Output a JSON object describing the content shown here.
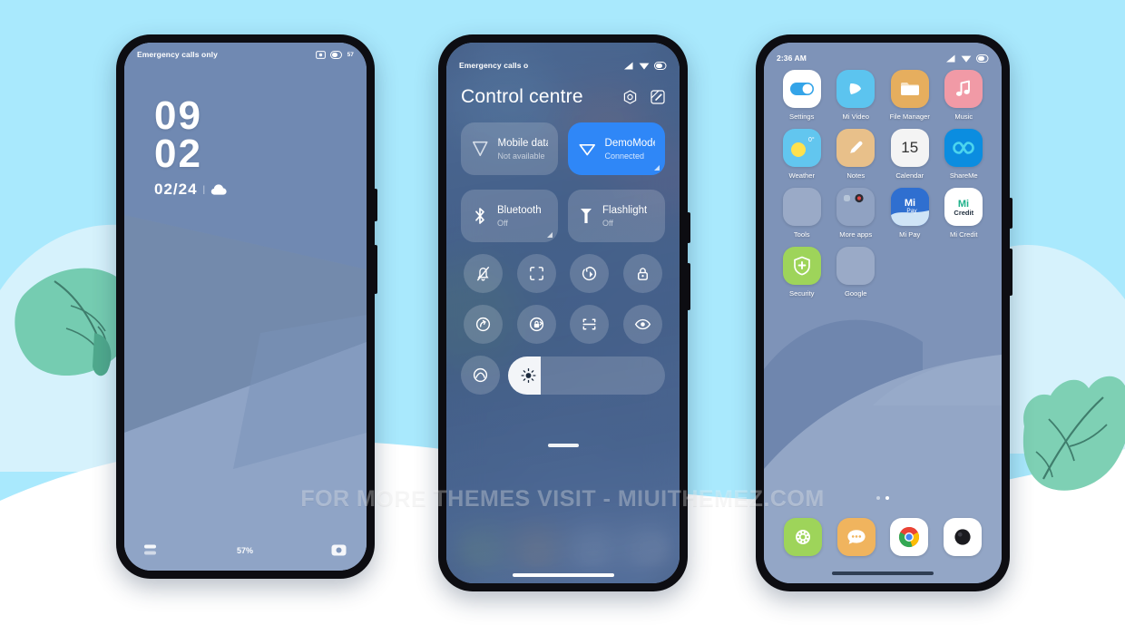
{
  "page": {
    "background_color": "#a9e9fd",
    "watermark": "FOR MORE THEMES VISIT - MIUITHEMEZ.COM"
  },
  "lockscreen": {
    "statusbar": {
      "carrier": "Emergency calls only",
      "battery_percent": "57",
      "icons": [
        "screenshot-icon",
        "battery-icon"
      ]
    },
    "clock": {
      "hours": "09",
      "minutes": "02"
    },
    "date": "02/24",
    "separator": "|",
    "weather_icon": "cloud-icon",
    "battery_label": "57%",
    "left_shortcut_icon": "notes-shortcut-icon",
    "right_shortcut_icon": "camera-shortcut-icon"
  },
  "controlcentre": {
    "statusbar": {
      "carrier": "Emergency calls o",
      "icons": [
        "signal-icon",
        "wifi-icon",
        "battery-icon"
      ]
    },
    "title": "Control centre",
    "header_icons": [
      "settings-gear-icon",
      "edit-pencil-icon"
    ],
    "big_tiles": [
      {
        "label": "Mobile data",
        "sub": "Not available",
        "icon": "mobile-data-icon",
        "active": false,
        "corner": false
      },
      {
        "label": "DemoMode",
        "sub": "Connected",
        "icon": "wifi-triangle-icon",
        "active": true,
        "corner": true
      }
    ],
    "wide_tiles": [
      {
        "label": "Bluetooth",
        "sub": "Off",
        "icon": "bluetooth-icon",
        "active": false,
        "corner": true
      },
      {
        "label": "Flashlight",
        "sub": "Off",
        "icon": "flashlight-icon",
        "active": false,
        "corner": false
      }
    ],
    "round_tiles": [
      {
        "icon": "silent-bell-icon"
      },
      {
        "icon": "screenshot-frame-icon"
      },
      {
        "icon": "auto-rotate-icon"
      },
      {
        "icon": "lock-icon"
      },
      {
        "icon": "data-saver-icon"
      },
      {
        "icon": "rotation-lock-icon"
      },
      {
        "icon": "scan-icon"
      },
      {
        "icon": "reading-mode-eye-icon"
      },
      {
        "icon": "dark-mode-icon"
      }
    ],
    "brightness": {
      "icon": "brightness-sun-icon",
      "value_percent": 21
    },
    "drag_handle": "cc-drag-handle",
    "nav_bar": "gesture-nav-bar"
  },
  "homescreen": {
    "statusbar": {
      "time": "2:36 AM",
      "icons": [
        "signal-icon",
        "wifi-icon",
        "battery-icon"
      ]
    },
    "apps": [
      {
        "label": "Settings",
        "icon": "settings-toggle-icon",
        "bg": "#ffffff"
      },
      {
        "label": "Mi Video",
        "icon": "play-icon",
        "bg": "#5cc4ef"
      },
      {
        "label": "File Manager",
        "icon": "folder-icon",
        "bg": "#e6ae5e"
      },
      {
        "label": "Music",
        "icon": "music-note-icon",
        "bg": "#f19aa6"
      },
      {
        "label": "Weather",
        "icon": "sun-cloud-icon",
        "bg": "#62c6ef"
      },
      {
        "label": "Notes",
        "icon": "pencil-icon",
        "bg": "#e8c08a"
      },
      {
        "label": "Calendar",
        "icon": "calendar-15-icon",
        "bg": "#f4f4f4"
      },
      {
        "label": "ShareMe",
        "icon": "infinity-icon",
        "bg": "#0b8de0"
      },
      {
        "label": "Tools",
        "icon": "tools-folder-icon",
        "bg": "#8fb0d4"
      },
      {
        "label": "More apps",
        "icon": "more-apps-folder-icon",
        "bg": "#8fa8c8"
      },
      {
        "label": "Mi Pay",
        "icon": "mi-pay-icon",
        "bg": "#2f6fd0"
      },
      {
        "label": "Mi Credit",
        "icon": "mi-credit-icon",
        "bg": "#ffffff"
      },
      {
        "label": "Security",
        "icon": "shield-plus-icon",
        "bg": "#9ed45a"
      },
      {
        "label": "Google",
        "icon": "google-folder-icon",
        "bg": "#8fa8c8"
      }
    ],
    "calendar_day": "15",
    "mi_pay_text": "Mi Pay",
    "mi_credit_text": "Credit",
    "page_dots": {
      "count": 2,
      "active_index": 1
    },
    "dock": [
      {
        "label": "Phone",
        "icon": "phone-dialer-icon",
        "bg": "#9ed45a"
      },
      {
        "label": "Messages",
        "icon": "message-bubble-icon",
        "bg": "#f0b45e"
      },
      {
        "label": "Chrome",
        "icon": "chrome-icon",
        "bg": "#ffffff"
      },
      {
        "label": "Camera",
        "icon": "camera-lens-icon",
        "bg": "#ffffff"
      }
    ],
    "nav_bar": "gesture-nav-bar"
  }
}
